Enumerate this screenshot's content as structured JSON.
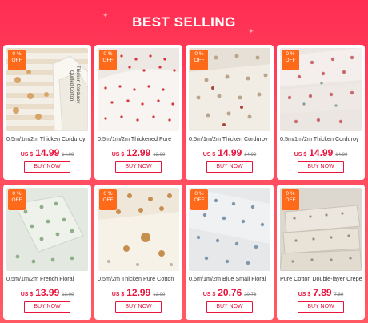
{
  "banner": {
    "title": "BEST SELLING"
  },
  "discount_badge": {
    "line1": "0  %",
    "line2": "OFF"
  },
  "products": [
    {
      "title": "0.5m/1m/2m Thicken Corduroy",
      "currency": "US $",
      "price": "14.99",
      "old_price": "14.99",
      "buy": "BUY NOW",
      "image_text": [
        "Thicken Corduroy",
        "Quilted Cotton"
      ]
    },
    {
      "title": "0.5m/1m/2m Thickened Pure",
      "currency": "US $",
      "price": "12.99",
      "old_price": "12.99",
      "buy": "BUY NOW"
    },
    {
      "title": "0.5m/1m/2m Thicken Corduroy",
      "currency": "US $",
      "price": "14.99",
      "old_price": "14.99",
      "buy": "BUY NOW"
    },
    {
      "title": "0.5m/1m/2m Thicken Corduroy",
      "currency": "US $",
      "price": "14.99",
      "old_price": "14.99",
      "buy": "BUY NOW"
    },
    {
      "title": "0.5m/1m/2m French Floral",
      "currency": "US $",
      "price": "13.99",
      "old_price": "13.99",
      "buy": "BUY NOW"
    },
    {
      "title": "0.5m/2m Thicken Pure Cotton",
      "currency": "US $",
      "price": "12.99",
      "old_price": "12.99",
      "buy": "BUY NOW"
    },
    {
      "title": "0.5m/1m/2m Blue Small Floral",
      "currency": "US $",
      "price": "20.76",
      "old_price": "20.76",
      "buy": "BUY NOW"
    },
    {
      "title": "Pure Cotton Double-layer Crepe",
      "currency": "US $",
      "price": "7.89",
      "old_price": "7.89",
      "buy": "BUY NOW"
    }
  ],
  "colors": {
    "accent": "#e8143c",
    "badge": "#ff6a1a"
  }
}
